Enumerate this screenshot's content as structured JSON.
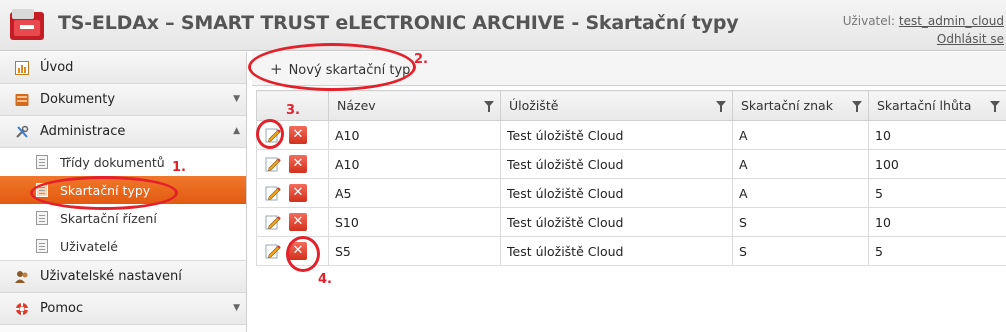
{
  "header": {
    "title": "TS-ELDAx – SMART TRUST eLECTRONIC ARCHIVE - Skartační typy",
    "user_label": "Uživatel:",
    "user_name": "test_admin_cloud",
    "logout": "Odhlásit se"
  },
  "sidebar": {
    "nav": [
      {
        "label": "Úvod"
      },
      {
        "label": "Dokumenty"
      },
      {
        "label": "Administrace"
      },
      {
        "label": "Uživatelské nastavení"
      },
      {
        "label": "Pomoc"
      }
    ],
    "admin_items": [
      {
        "label": "Třídy dokumentů"
      },
      {
        "label": "Skartační typy"
      },
      {
        "label": "Skartační řízení"
      },
      {
        "label": "Uživatelé"
      }
    ]
  },
  "toolbar": {
    "new_label": "Nový skartační typ"
  },
  "table": {
    "columns": [
      "Název",
      "Úložiště",
      "Skartační znak",
      "Skartační lhůta"
    ],
    "rows": [
      {
        "name": "A10",
        "storage": "Test úložiště Cloud",
        "sign": "A",
        "period": "10"
      },
      {
        "name": "A10",
        "storage": "Test úložiště Cloud",
        "sign": "A",
        "period": "100"
      },
      {
        "name": "A5",
        "storage": "Test úložiště Cloud",
        "sign": "A",
        "period": "5"
      },
      {
        "name": "S10",
        "storage": "Test úložiště Cloud",
        "sign": "S",
        "period": "10"
      },
      {
        "name": "S5",
        "storage": "Test úložiště Cloud",
        "sign": "S",
        "period": "5"
      }
    ]
  },
  "annotations": [
    "1.",
    "2.",
    "3.",
    "4."
  ],
  "colors": {
    "accent": "#e8631a",
    "annotation": "#e3212b"
  }
}
